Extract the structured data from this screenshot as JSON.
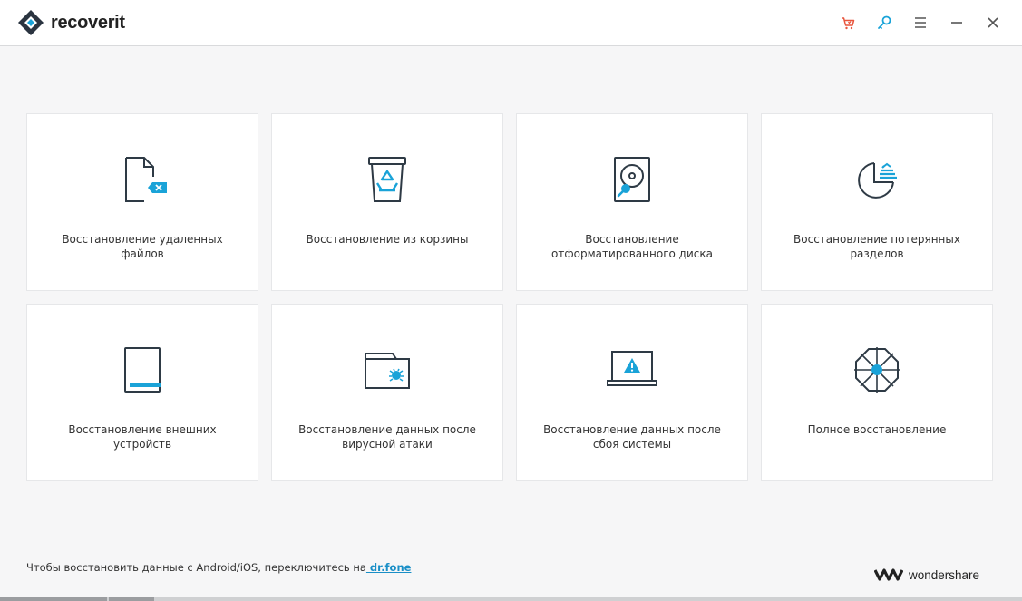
{
  "app": {
    "name": "recoverit"
  },
  "toolbar": {
    "buttons": [
      {
        "name": "cart-icon"
      },
      {
        "name": "key-icon"
      },
      {
        "name": "menu-icon"
      },
      {
        "name": "minimize-icon"
      },
      {
        "name": "close-icon"
      }
    ]
  },
  "colors": {
    "accent": "#1aa3d8",
    "cart": "#e8553d",
    "icon_stroke": "#2e3a45"
  },
  "cards": [
    {
      "label": "Восстановление удаленных файлов",
      "icon": "deleted-file-icon"
    },
    {
      "label": "Восстановление из корзины",
      "icon": "recycle-bin-icon"
    },
    {
      "label": "Восстановление отформатированного диска",
      "icon": "formatted-disk-icon"
    },
    {
      "label": "Восстановление потерянных разделов",
      "icon": "lost-partition-icon"
    },
    {
      "label": "Восстановление внешних устройств",
      "icon": "external-device-icon"
    },
    {
      "label": "Восстановление данных после вирусной атаки",
      "icon": "virus-folder-icon"
    },
    {
      "label": "Восстановление данных после сбоя системы",
      "icon": "system-crash-icon"
    },
    {
      "label": "Полное восстановление",
      "icon": "full-recovery-icon"
    }
  ],
  "footer": {
    "text": "Чтобы восстановить данные с Android/iOS, переключитесь на",
    "link": " dr.fone",
    "brand": "wondershare"
  }
}
